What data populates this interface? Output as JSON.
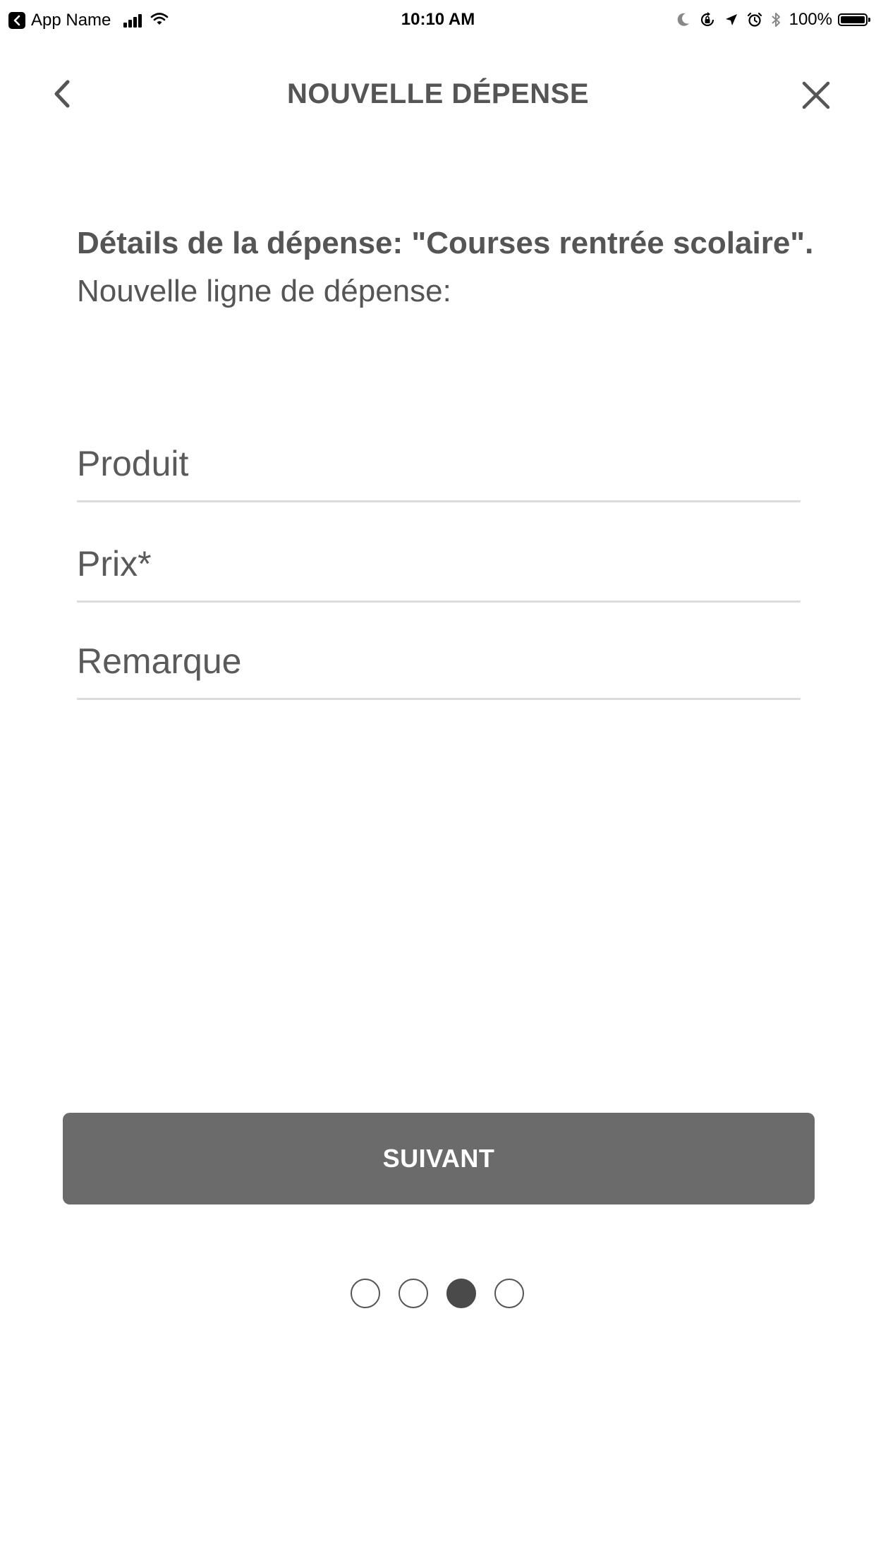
{
  "status_bar": {
    "app_name": "App Name",
    "time": "10:10 AM",
    "battery_percent": "100%",
    "icons": [
      "back-to-app-icon",
      "signal-icon",
      "wifi-icon",
      "moon-icon",
      "rotation-lock-icon",
      "location-icon",
      "alarm-icon",
      "bluetooth-icon",
      "battery-icon"
    ]
  },
  "header": {
    "title": "NOUVELLE DÉPENSE",
    "back_icon": "chevron-left-icon",
    "close_icon": "close-icon"
  },
  "intro": {
    "heading": "Détails de la dépense: \"Courses rentrée scolaire\".",
    "subheading": "Nouvelle ligne de dépense:"
  },
  "form": {
    "product": {
      "placeholder": "Produit",
      "value": ""
    },
    "price": {
      "placeholder": "Prix*",
      "value": ""
    },
    "remark": {
      "placeholder": "Remarque",
      "value": ""
    }
  },
  "actions": {
    "next_label": "SUIVANT"
  },
  "pager": {
    "total": 4,
    "current": 3
  },
  "colors": {
    "text": "#555555",
    "button_bg": "#6b6b6b",
    "button_text": "#ffffff",
    "field_underline": "#dcdcdc",
    "dot_active": "#4a4a4a"
  }
}
